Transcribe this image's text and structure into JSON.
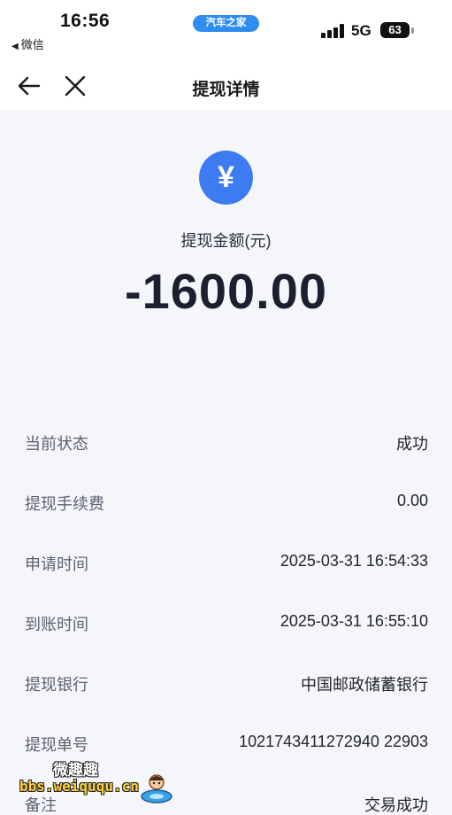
{
  "status_bar": {
    "time": "16:56",
    "back_app": "微信",
    "app_pill": "汽车之家",
    "network": "5G",
    "battery": "63"
  },
  "nav": {
    "title": "提现详情",
    "back_icon": "arrow-left-icon",
    "close_icon": "close-icon"
  },
  "amount": {
    "icon": "yen-icon",
    "icon_glyph": "¥",
    "label": "提现金额(元)",
    "value": "-1600.00"
  },
  "details": [
    {
      "key": "当前状态",
      "value": "成功"
    },
    {
      "key": "提现手续费",
      "value": "0.00"
    },
    {
      "key": "申请时间",
      "value": "2025-03-31 16:54:33"
    },
    {
      "key": "到账时间",
      "value": "2025-03-31 16:55:10"
    },
    {
      "key": "提现银行",
      "value": "中国邮政储蓄银行"
    },
    {
      "key": "提现单号",
      "value": "1021743411272940 22903"
    },
    {
      "key": "备注",
      "value": "交易成功"
    }
  ],
  "watermark": {
    "title": "微趣趣",
    "url": "bbs.weiququ.cn"
  },
  "colors": {
    "accent": "#3d7bf2",
    "pill": "#2f8cf0",
    "background": "#f5f6fa"
  }
}
